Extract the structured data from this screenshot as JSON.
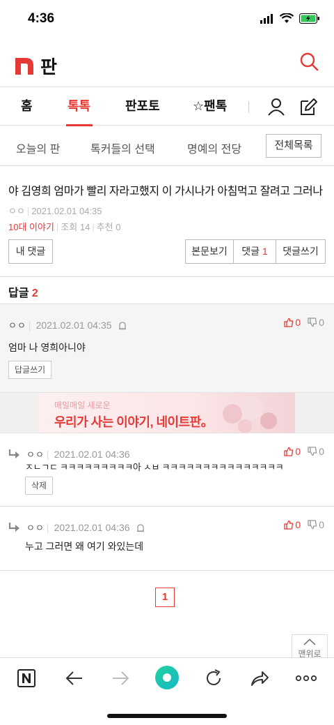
{
  "status_bar": {
    "time": "4:36"
  },
  "header": {
    "logo_text": "판",
    "search_icon": "search-icon"
  },
  "main_nav": {
    "items": [
      "홈",
      "톡톡",
      "판포토",
      "☆팬톡"
    ],
    "active": "톡톡"
  },
  "sub_nav": {
    "items": [
      "오늘의 판",
      "톡커들의 선택",
      "명예의 전당"
    ],
    "all_list": "전체목록"
  },
  "post": {
    "title": "야 김영희 엄마가 빨리 자라고했지 이 가시나가 아침먹고 잘려고 그러나",
    "author": "ㅇㅇ",
    "date": "2021.02.01 04:35",
    "category": "10대 이야기",
    "views": "조회 14",
    "recommend": "추천 0"
  },
  "buttons": {
    "my_comments": "내 댓글",
    "view_body": "본문보기",
    "comments_label": "댓글",
    "comments_count": "1",
    "write_comment": "댓글쓰기"
  },
  "replies": {
    "label": "답글",
    "count": "2"
  },
  "comments": [
    {
      "author": "ㅇㅇ",
      "date": "2021.02.01 04:35",
      "up": "0",
      "down": "0",
      "body": "엄마 나 영희아니야",
      "action": "답글쓰기"
    },
    {
      "author": "ㅇㅇ",
      "date": "2021.02.01 04:36",
      "up": "0",
      "down": "0",
      "body": "ㅈㄴㄱㄷ ㅋㅋㅋㅋㅋㅋㅋㅋㅋ아 ㅅㅂ ㅋㅋㅋㅋㅋㅋㅋㅋㅋㅋㅋㅋㅋㅋㅋ",
      "action": "삭제"
    },
    {
      "author": "ㅇㅇ",
      "date": "2021.02.01 04:36",
      "up": "0",
      "down": "0",
      "body": "누고 그러면 왜 여기 와있는데"
    }
  ],
  "ad": {
    "small": "매일매일 새로운",
    "big": "우리가 사는 이야기, 네이트판。"
  },
  "pagination": {
    "current": "1"
  },
  "top_button": {
    "label": "맨위로"
  },
  "colors": {
    "accent": "#e53935"
  }
}
